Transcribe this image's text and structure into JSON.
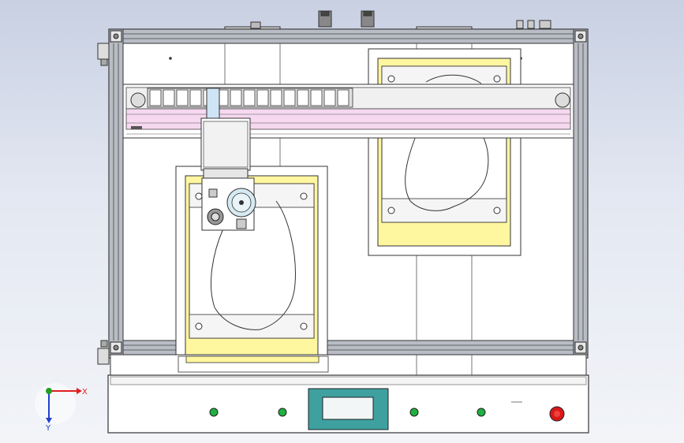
{
  "viewport": {
    "background": [
      "#c8d0e2",
      "#f2f4f8"
    ]
  },
  "triad": {
    "x_label": "X",
    "y_label": "Y",
    "x_color": "#e02020",
    "y_color": "#2040d0",
    "z_color": "#20a020"
  },
  "machine": {
    "frame_color": "#b8bcc4",
    "panel_color": "#ffffff",
    "bed_color": "#fff6a0",
    "gantry_stripe_color": "#f6d8f0",
    "display_color": "#3fa0a0",
    "indicator_color": "#20b040",
    "stop_button_color": "#d81818",
    "indicator_lights": 4
  }
}
